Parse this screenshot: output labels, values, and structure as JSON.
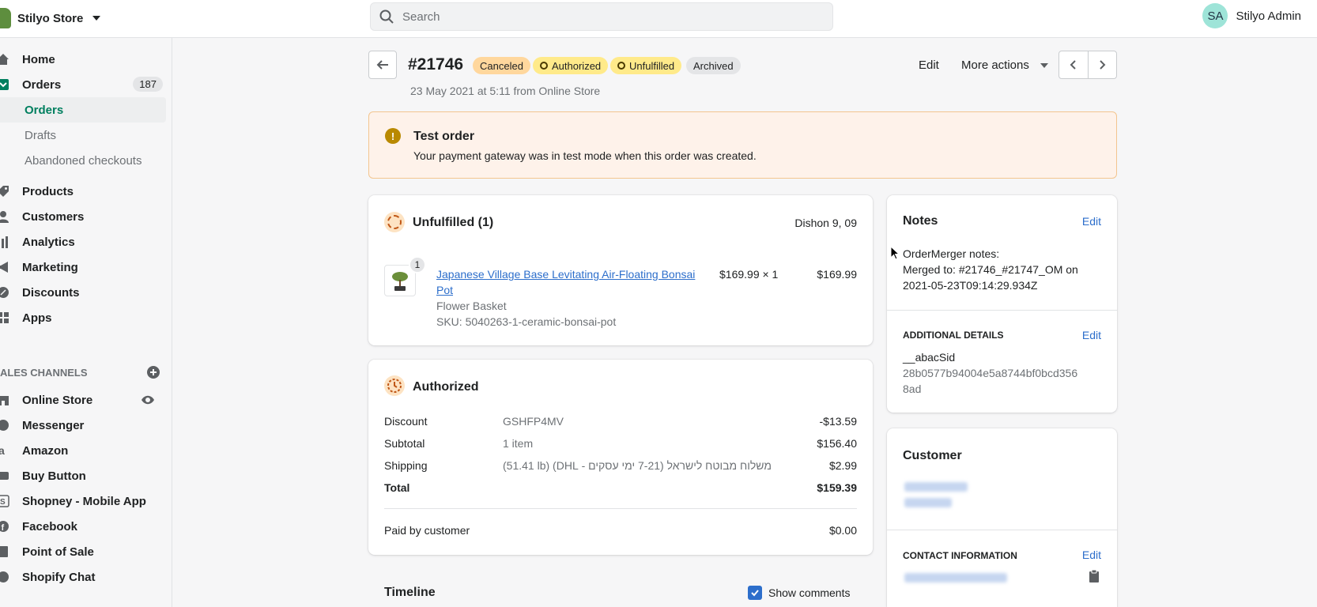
{
  "topbar": {
    "store_name": "Stilyo Store",
    "search_placeholder": "Search",
    "user_initials": "SA",
    "user_name": "Stilyo Admin"
  },
  "sidebar": {
    "home": "Home",
    "orders": "Orders",
    "orders_count": "187",
    "orders_sub": "Orders",
    "drafts": "Drafts",
    "abandoned": "Abandoned checkouts",
    "products": "Products",
    "customers": "Customers",
    "analytics": "Analytics",
    "marketing": "Marketing",
    "discounts": "Discounts",
    "apps": "Apps",
    "sales_channels": "ALES CHANNELS",
    "channels": {
      "online_store": "Online Store",
      "messenger": "Messenger",
      "amazon": "Amazon",
      "buy_button": "Buy Button",
      "shopney": "Shopney - Mobile App",
      "facebook": "Facebook",
      "pos": "Point of Sale",
      "shopify_chat": "Shopify Chat"
    }
  },
  "order": {
    "number": "#21746",
    "tags": {
      "canceled": "Canceled",
      "authorized": "Authorized",
      "unfulfilled": "Unfulfilled",
      "archived": "Archived"
    },
    "meta": "23 May 2021 at 5:11 from Online Store",
    "edit": "Edit",
    "more_actions": "More actions"
  },
  "banner": {
    "title": "Test order",
    "text": "Your payment gateway was in test mode when this order was created."
  },
  "unfulfilled": {
    "title": "Unfulfilled (1)",
    "location": "Dishon 9, 09",
    "qty_badge": "1",
    "product_line1": "Japanese Village Base Levitating Air-Floating Bonsai",
    "product_line2": "Pot",
    "variant": "Flower Basket",
    "sku": "SKU: 5040263-1-ceramic-bonsai-pot",
    "unit_price": "$169.99 × 1",
    "total": "$169.99"
  },
  "authorized": {
    "title": "Authorized",
    "rows": [
      {
        "label": "Discount",
        "detail": "GSHFP4MV",
        "amount": "-$13.59"
      },
      {
        "label": "Subtotal",
        "detail": "1 item",
        "amount": "$156.40"
      },
      {
        "label": "Shipping",
        "detail": "משלוח מבוטח לישראל (7-21 ימי עסקים - DHL) (51.41 lb)",
        "amount": "$2.99"
      },
      {
        "label": "Total",
        "detail": "",
        "amount": "$159.39"
      }
    ],
    "paid_label": "Paid by customer",
    "paid_amount": "$0.00"
  },
  "timeline": {
    "title": "Timeline",
    "show_comments": "Show comments"
  },
  "notes": {
    "title": "Notes",
    "edit": "Edit",
    "line1": "OrderMerger notes:",
    "line2": "Merged to: #21746_#21747_OM on",
    "line3": "2021-05-23T09:14:29.934Z"
  },
  "additional": {
    "title": "ADDITIONAL DETAILS",
    "edit": "Edit",
    "key": "__abacSid",
    "value1": "28b0577b94004e5a8744bf0bcd356",
    "value2": "8ad"
  },
  "customer": {
    "title": "Customer",
    "contact_title": "CONTACT INFORMATION",
    "edit": "Edit"
  },
  "colors": {
    "accent": "#007f5f",
    "link": "#2c6ecb",
    "canceled_tag": "#ffd79d",
    "authorized_tag": "#ffea8a",
    "archived_tag": "#e4e5e7",
    "banner_bg": "#fef2ea"
  }
}
